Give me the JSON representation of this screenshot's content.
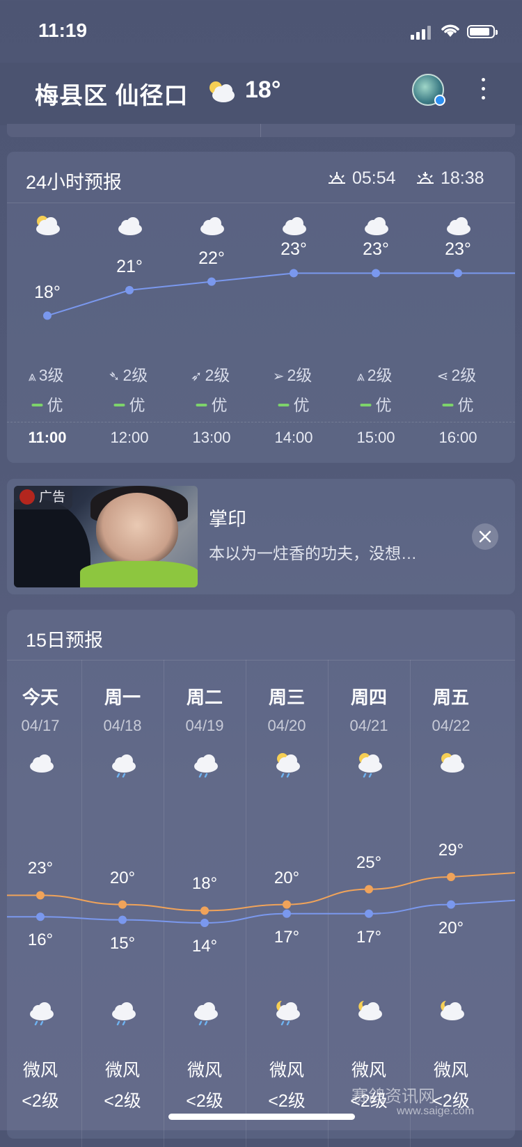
{
  "status_bar": {
    "time": "11:19"
  },
  "header": {
    "location": "梅县区 仙径口",
    "temperature": "18°",
    "weather_icon": "partly-cloudy-icon"
  },
  "hourly": {
    "title": "24小时预报",
    "sunrise": "05:54",
    "sunset": "18:38",
    "items": [
      {
        "time": "11:00",
        "temp": "18°",
        "temp_value": 18,
        "icon": "partly-cloudy-icon",
        "wind_dir": "⩓",
        "wind": "3级",
        "aqi": "优",
        "current": true
      },
      {
        "time": "12:00",
        "temp": "21°",
        "temp_value": 21,
        "icon": "cloud-icon",
        "wind_dir": "➴",
        "wind": "2级",
        "aqi": "优",
        "current": false
      },
      {
        "time": "13:00",
        "temp": "22°",
        "temp_value": 22,
        "icon": "cloud-icon",
        "wind_dir": "➶",
        "wind": "2级",
        "aqi": "优",
        "current": false
      },
      {
        "time": "14:00",
        "temp": "23°",
        "temp_value": 23,
        "icon": "cloud-icon",
        "wind_dir": "➢",
        "wind": "2级",
        "aqi": "优",
        "current": false
      },
      {
        "time": "15:00",
        "temp": "23°",
        "temp_value": 23,
        "icon": "cloud-icon",
        "wind_dir": "⩓",
        "wind": "2级",
        "aqi": "优",
        "current": false
      },
      {
        "time": "16:00",
        "temp": "23°",
        "temp_value": 23,
        "icon": "cloud-icon",
        "wind_dir": "⋖",
        "wind": "2级",
        "aqi": "优",
        "current": false
      }
    ]
  },
  "ad": {
    "tag": "广告",
    "title": "掌印",
    "description": "本以为一炷香的功夫，没想…"
  },
  "daily": {
    "title": "15日预报",
    "items": [
      {
        "day": "今天",
        "date": "04/17",
        "day_icon": "cloud-icon",
        "high": "23°",
        "high_value": 23,
        "low": "16°",
        "low_value": 16,
        "night_icon": "rain-icon",
        "wind": "微风",
        "level": "<2级"
      },
      {
        "day": "周一",
        "date": "04/18",
        "day_icon": "rain-icon",
        "high": "20°",
        "high_value": 20,
        "low": "15°",
        "low_value": 15,
        "night_icon": "rain-icon",
        "wind": "微风",
        "level": "<2级"
      },
      {
        "day": "周二",
        "date": "04/19",
        "day_icon": "rain-icon",
        "high": "18°",
        "high_value": 18,
        "low": "14°",
        "low_value": 14,
        "night_icon": "rain-icon",
        "wind": "微风",
        "level": "<2级"
      },
      {
        "day": "周三",
        "date": "04/20",
        "day_icon": "sun-rain-icon",
        "high": "20°",
        "high_value": 20,
        "low": "17°",
        "low_value": 17,
        "night_icon": "moon-rain-icon",
        "wind": "微风",
        "level": "<2级"
      },
      {
        "day": "周四",
        "date": "04/21",
        "day_icon": "sun-rain-icon",
        "high": "25°",
        "high_value": 25,
        "low": "17°",
        "low_value": 17,
        "night_icon": "moon-cloud-icon",
        "wind": "微风",
        "level": "<2级"
      },
      {
        "day": "周五",
        "date": "04/22",
        "day_icon": "partly-cloudy-icon",
        "high": "29°",
        "high_value": 29,
        "low": "20°",
        "low_value": 20,
        "night_icon": "moon-cloud-icon",
        "wind": "微风",
        "level": "<2级"
      }
    ]
  },
  "watermark": {
    "text": "赛鸽资讯网",
    "url": "www.saige.com"
  },
  "colors": {
    "high_line": "#f0a35a",
    "low_line": "#7a98ee",
    "aqi_good": "#7dd36b"
  }
}
